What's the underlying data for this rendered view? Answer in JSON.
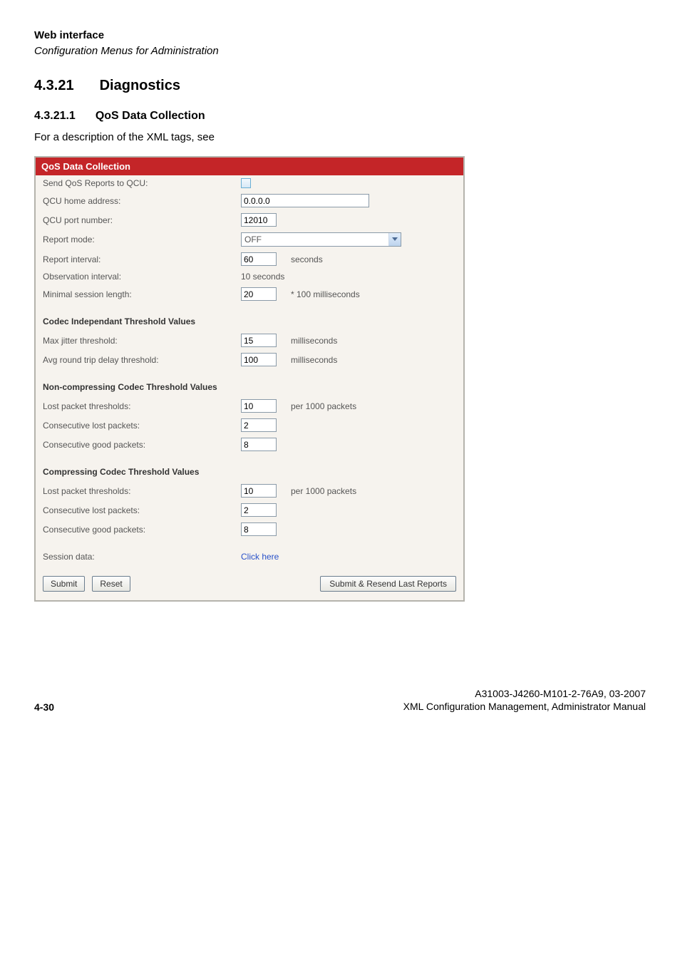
{
  "header": {
    "title_bold": "Web interface",
    "title_italic": "Configuration Menus for Administration"
  },
  "section": {
    "number": "4.3.21",
    "title": "Diagnostics",
    "sub_number": "4.3.21.1",
    "sub_title": "QoS Data Collection",
    "intro": "For a description of the XML tags, see"
  },
  "panel": {
    "title": "QoS Data Collection",
    "send_reports_label": "Send QoS Reports to QCU:",
    "home_addr_label": "QCU home address:",
    "home_addr_value": "0.0.0.0",
    "port_label": "QCU port number:",
    "port_value": "12010",
    "report_mode_label": "Report mode:",
    "report_mode_value": "OFF",
    "report_interval_label": "Report interval:",
    "report_interval_value": "60",
    "report_interval_unit": "seconds",
    "obs_interval_label": "Observation interval:",
    "obs_interval_value": "10 seconds",
    "min_session_label": "Minimal session length:",
    "min_session_value": "20",
    "min_session_unit": "* 100 milliseconds",
    "codec_indep_header": "Codec Independant Threshold Values",
    "max_jitter_label": "Max jitter threshold:",
    "max_jitter_value": "15",
    "max_jitter_unit": "milliseconds",
    "avg_rtd_label": "Avg round trip delay threshold:",
    "avg_rtd_value": "100",
    "avg_rtd_unit": "milliseconds",
    "noncomp_header": "Non-compressing Codec Threshold Values",
    "nc_lost_label": "Lost packet thresholds:",
    "nc_lost_value": "10",
    "nc_lost_unit": "per 1000 packets",
    "nc_cons_lost_label": "Consecutive lost packets:",
    "nc_cons_lost_value": "2",
    "nc_cons_good_label": "Consecutive good packets:",
    "nc_cons_good_value": "8",
    "comp_header": "Compressing Codec Threshold Values",
    "c_lost_label": "Lost packet thresholds:",
    "c_lost_value": "10",
    "c_lost_unit": "per 1000 packets",
    "c_cons_lost_label": "Consecutive lost packets:",
    "c_cons_lost_value": "2",
    "c_cons_good_label": "Consecutive good packets:",
    "c_cons_good_value": "8",
    "session_data_label": "Session data:",
    "session_data_link": "Click here",
    "btn_submit": "Submit",
    "btn_reset": "Reset",
    "btn_resend": "Submit & Resend Last Reports"
  },
  "footer": {
    "page_num": "4-30",
    "doc_id": "A31003-J4260-M101-2-76A9, 03-2007",
    "doc_title": "XML Configuration Management, Administrator Manual"
  }
}
